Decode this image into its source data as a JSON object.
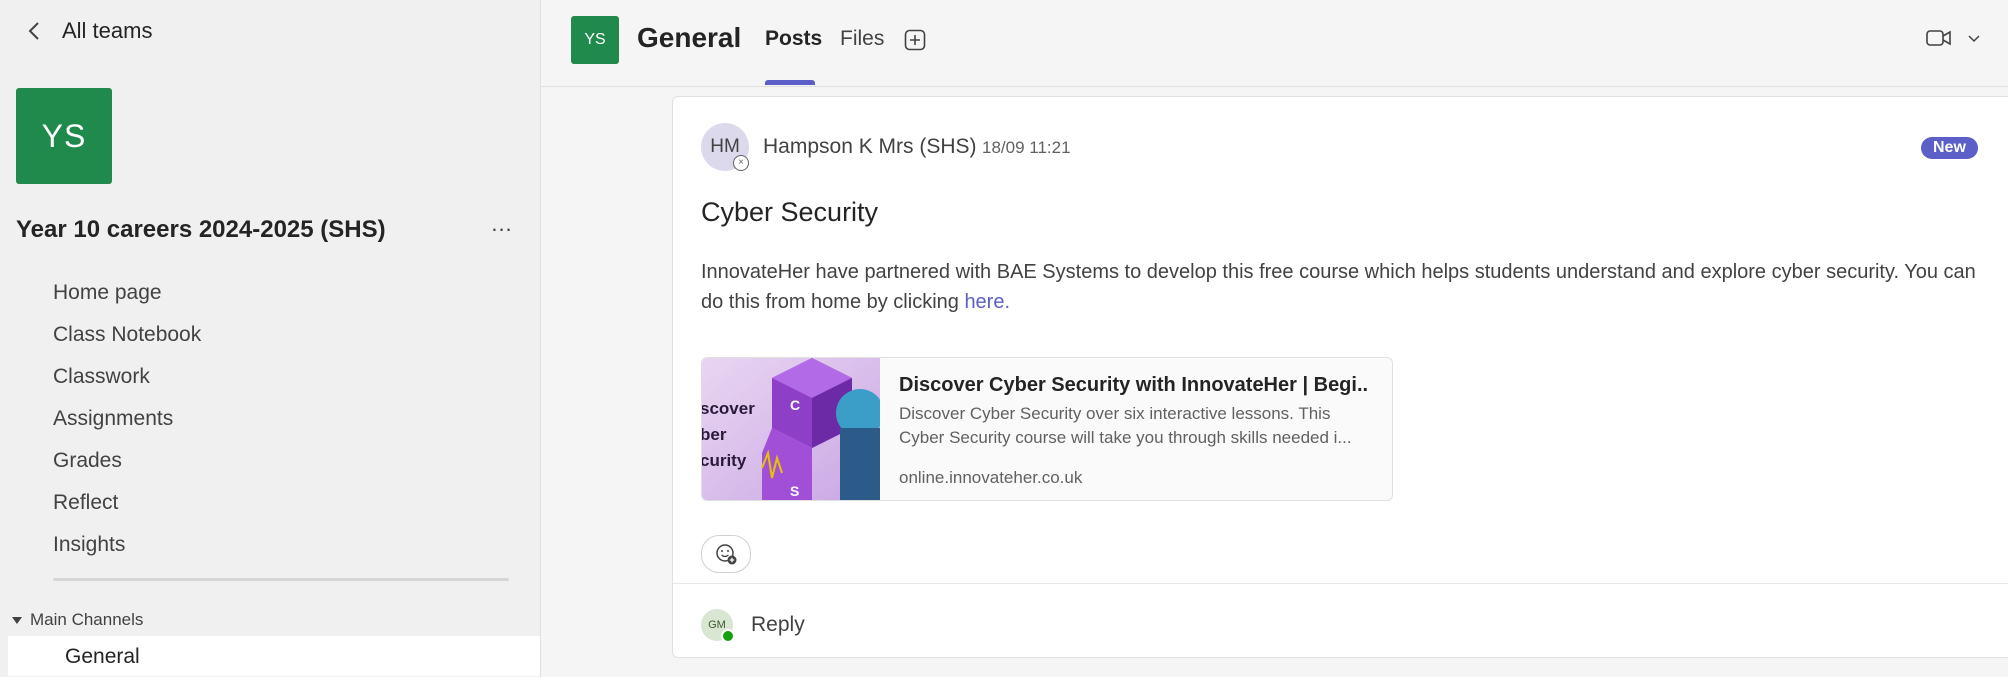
{
  "sidebar": {
    "back_label": "All teams",
    "team_initials": "YS",
    "team_name": "Year 10 careers 2024-2025 (SHS)",
    "more_label": "...",
    "nav_items": [
      {
        "label": "Home page"
      },
      {
        "label": "Class Notebook"
      },
      {
        "label": "Classwork"
      },
      {
        "label": "Assignments"
      },
      {
        "label": "Grades"
      },
      {
        "label": "Reflect"
      },
      {
        "label": "Insights"
      }
    ],
    "channels_header": "Main Channels",
    "channels": [
      {
        "label": "General"
      }
    ]
  },
  "header": {
    "channel_initials": "YS",
    "channel_title": "General",
    "tabs": [
      {
        "label": "Posts",
        "active": true
      },
      {
        "label": "Files",
        "active": false
      }
    ],
    "icons": [
      "add-tab-icon",
      "video-icon",
      "chevron-down-icon"
    ]
  },
  "post": {
    "author_initials": "HM",
    "author_name": "Hampson K Mrs (SHS)",
    "time": "18/09 11:21",
    "badge": "New",
    "subject": "Cyber Security",
    "body_text": "InnovateHer have partnered with BAE Systems to develop this free course which helps students understand and explore cyber security. You can do this from home by clicking ",
    "body_link": "here.",
    "link_card": {
      "title": "Discover Cyber Security with InnovateHer | Begi...",
      "description": "Discover Cyber Security over six interactive lessons. This Cyber Security course will take you through skills needed i...",
      "url": "online.innovateher.co.uk",
      "thumb_text": [
        "scover",
        "ber",
        "curity"
      ],
      "thumb_letters": [
        "C",
        "S"
      ]
    },
    "reply": {
      "user_initials": "GM",
      "label": "Reply"
    }
  },
  "colors": {
    "brand_green": "#1f8a4c",
    "accent": "#5b5fc7",
    "presence_green": "#13a10e"
  }
}
